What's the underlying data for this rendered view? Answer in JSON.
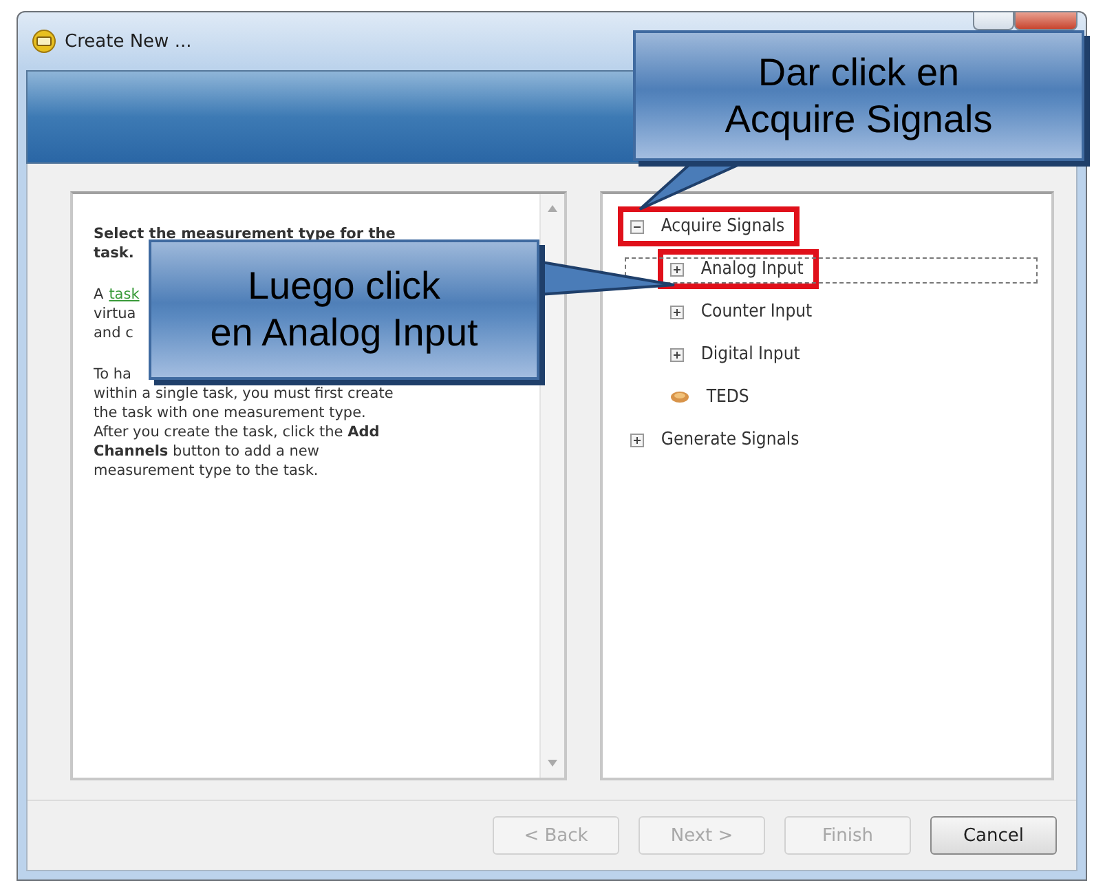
{
  "window": {
    "title": "Create New ..."
  },
  "help": {
    "lines": [
      {
        "parts": [
          {
            "text": "Select the measurement type for the",
            "kind": "bold"
          }
        ]
      },
      {
        "parts": [
          {
            "text": "task.",
            "kind": "bold"
          }
        ]
      },
      {
        "gap": true,
        "parts": [
          {
            "text": "A",
            "kind": "plain"
          },
          {
            "text": "task",
            "kind": "link"
          }
        ]
      },
      {
        "parts": [
          {
            "text": "virtua",
            "kind": "plain"
          }
        ]
      },
      {
        "parts": [
          {
            "text": "and c",
            "kind": "plain"
          }
        ]
      },
      {
        "gap": true,
        "parts": [
          {
            "text": "To ha",
            "kind": "plain"
          }
        ]
      },
      {
        "parts": [
          {
            "text": "within a single task, you must first create",
            "kind": "plain"
          }
        ]
      },
      {
        "parts": [
          {
            "text": "the task with one measurement type.",
            "kind": "plain"
          }
        ]
      },
      {
        "parts": [
          {
            "text": "After you create the task, click the **Add**",
            "kind": "plain"
          }
        ]
      },
      {
        "parts": [
          {
            "text": "**Channels** button to add a new",
            "kind": "plain"
          }
        ]
      },
      {
        "parts": [
          {
            "text": "measurement type to the task.",
            "kind": "plain"
          }
        ]
      }
    ]
  },
  "tree": [
    {
      "label": "Acquire Signals",
      "kind": "group",
      "expanded": true,
      "selected": false,
      "highlighted": true,
      "children": [
        {
          "label": "Analog Input",
          "kind": "group",
          "expanded": false,
          "selected": true,
          "highlighted": true
        },
        {
          "label": "Counter Input",
          "kind": "group",
          "expanded": false,
          "selected": false,
          "highlighted": false
        },
        {
          "label": "Digital Input",
          "kind": "group",
          "expanded": false,
          "selected": false,
          "highlighted": false
        },
        {
          "label": "TEDS",
          "kind": "leaf",
          "selected": false,
          "highlighted": false
        }
      ]
    },
    {
      "label": "Generate Signals",
      "kind": "group",
      "expanded": false,
      "selected": false,
      "highlighted": false
    }
  ],
  "buttons": [
    {
      "label": "< Back",
      "disabled": true
    },
    {
      "label": "Next >",
      "disabled": true
    },
    {
      "label": "Finish",
      "disabled": true
    },
    {
      "label": "Cancel",
      "disabled": false
    }
  ],
  "callouts": [
    {
      "lines": [
        "Dar click en",
        "Acquire Signals"
      ]
    },
    {
      "lines": [
        "Luego click",
        "en Analog Input"
      ]
    }
  ]
}
